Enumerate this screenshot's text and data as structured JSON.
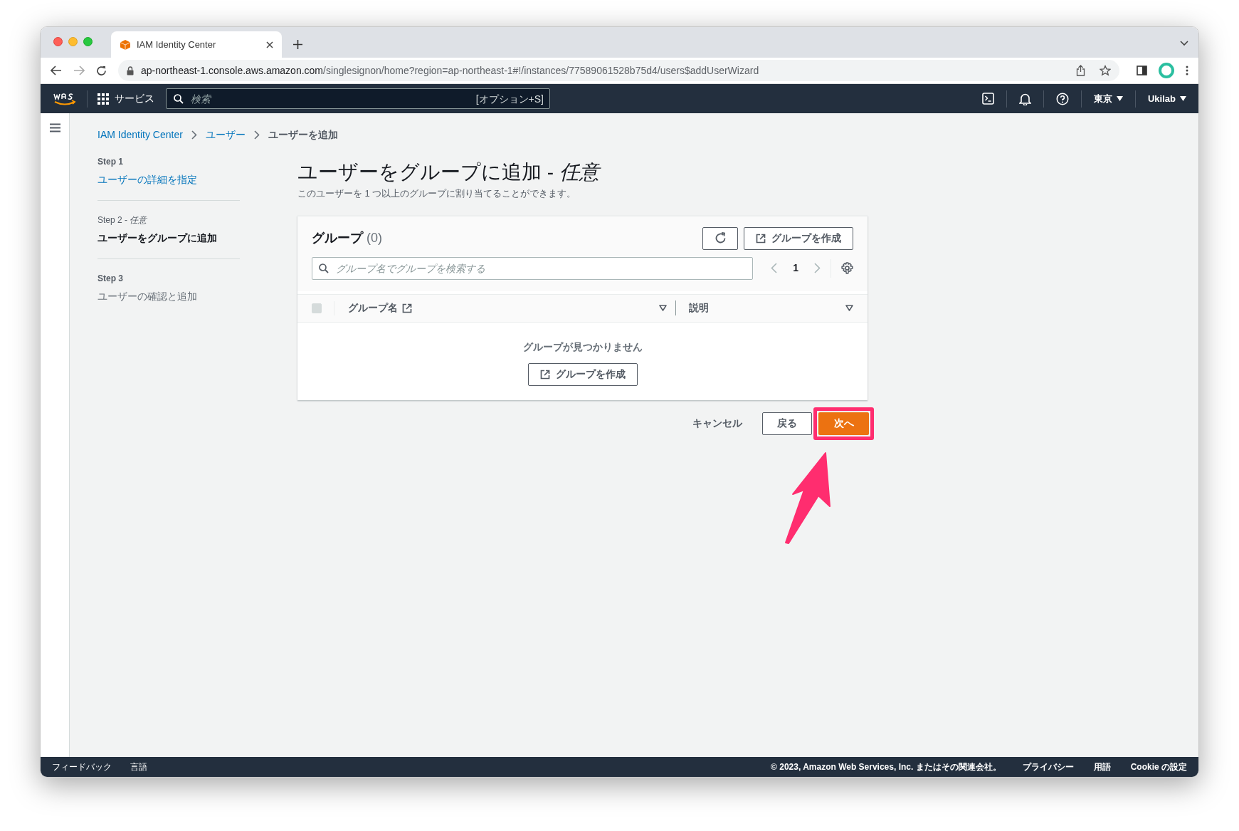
{
  "browser": {
    "tab_title": "IAM Identity Center",
    "url_host": "ap-northeast-1.console.aws.amazon.com",
    "url_path": "/singlesignon/home?region=ap-northeast-1#!/instances/77589061528b75d4/users$addUserWizard"
  },
  "aws_nav": {
    "services": "サービス",
    "search_placeholder": "検索",
    "search_shortcut": "[オプション+S]",
    "region": "東京",
    "account": "Ukilab"
  },
  "breadcrumb": [
    {
      "label": "IAM Identity Center",
      "link": true
    },
    {
      "label": "ユーザー",
      "link": true
    },
    {
      "label": "ユーザーを追加",
      "link": false
    }
  ],
  "steps": [
    {
      "step": "Step 1",
      "label": "ユーザーの詳細を指定",
      "completed": true,
      "selected": false
    },
    {
      "step": "Step 2 - *任意*",
      "label": "ユーザーをグループに追加",
      "completed": false,
      "selected": true
    },
    {
      "step": "Step 3",
      "label": "ユーザーの確認と追加",
      "completed": false,
      "selected": false
    }
  ],
  "page": {
    "title": "ユーザーをグループに追加 - *任意*",
    "description": "このユーザーを 1 つ以上のグループに割り当てることができます。"
  },
  "groups_panel": {
    "title": "グループ",
    "count": "(0)",
    "create_button": "グループを作成",
    "search_placeholder": "グループ名でグループを検索する",
    "pages": [
      {
        "label": "1",
        "selected": true
      }
    ],
    "select_all": {
      "disabled": true
    },
    "columns": [
      {
        "label": "グループ名",
        "external": true
      },
      {
        "label": "説明",
        "external": false
      }
    ],
    "empty_message": "グループが見つかりません",
    "empty_create_button": "グループを作成"
  },
  "actions": {
    "cancel": "キャンセル",
    "back": "戻る",
    "next": "次へ"
  },
  "footer": {
    "left": [
      "フィードバック",
      "言語"
    ],
    "copyright": "© 2023, Amazon Web Services, Inc. またはその関連会社。",
    "links": [
      "プライバシー",
      "用語",
      "Cookie の設定"
    ]
  }
}
